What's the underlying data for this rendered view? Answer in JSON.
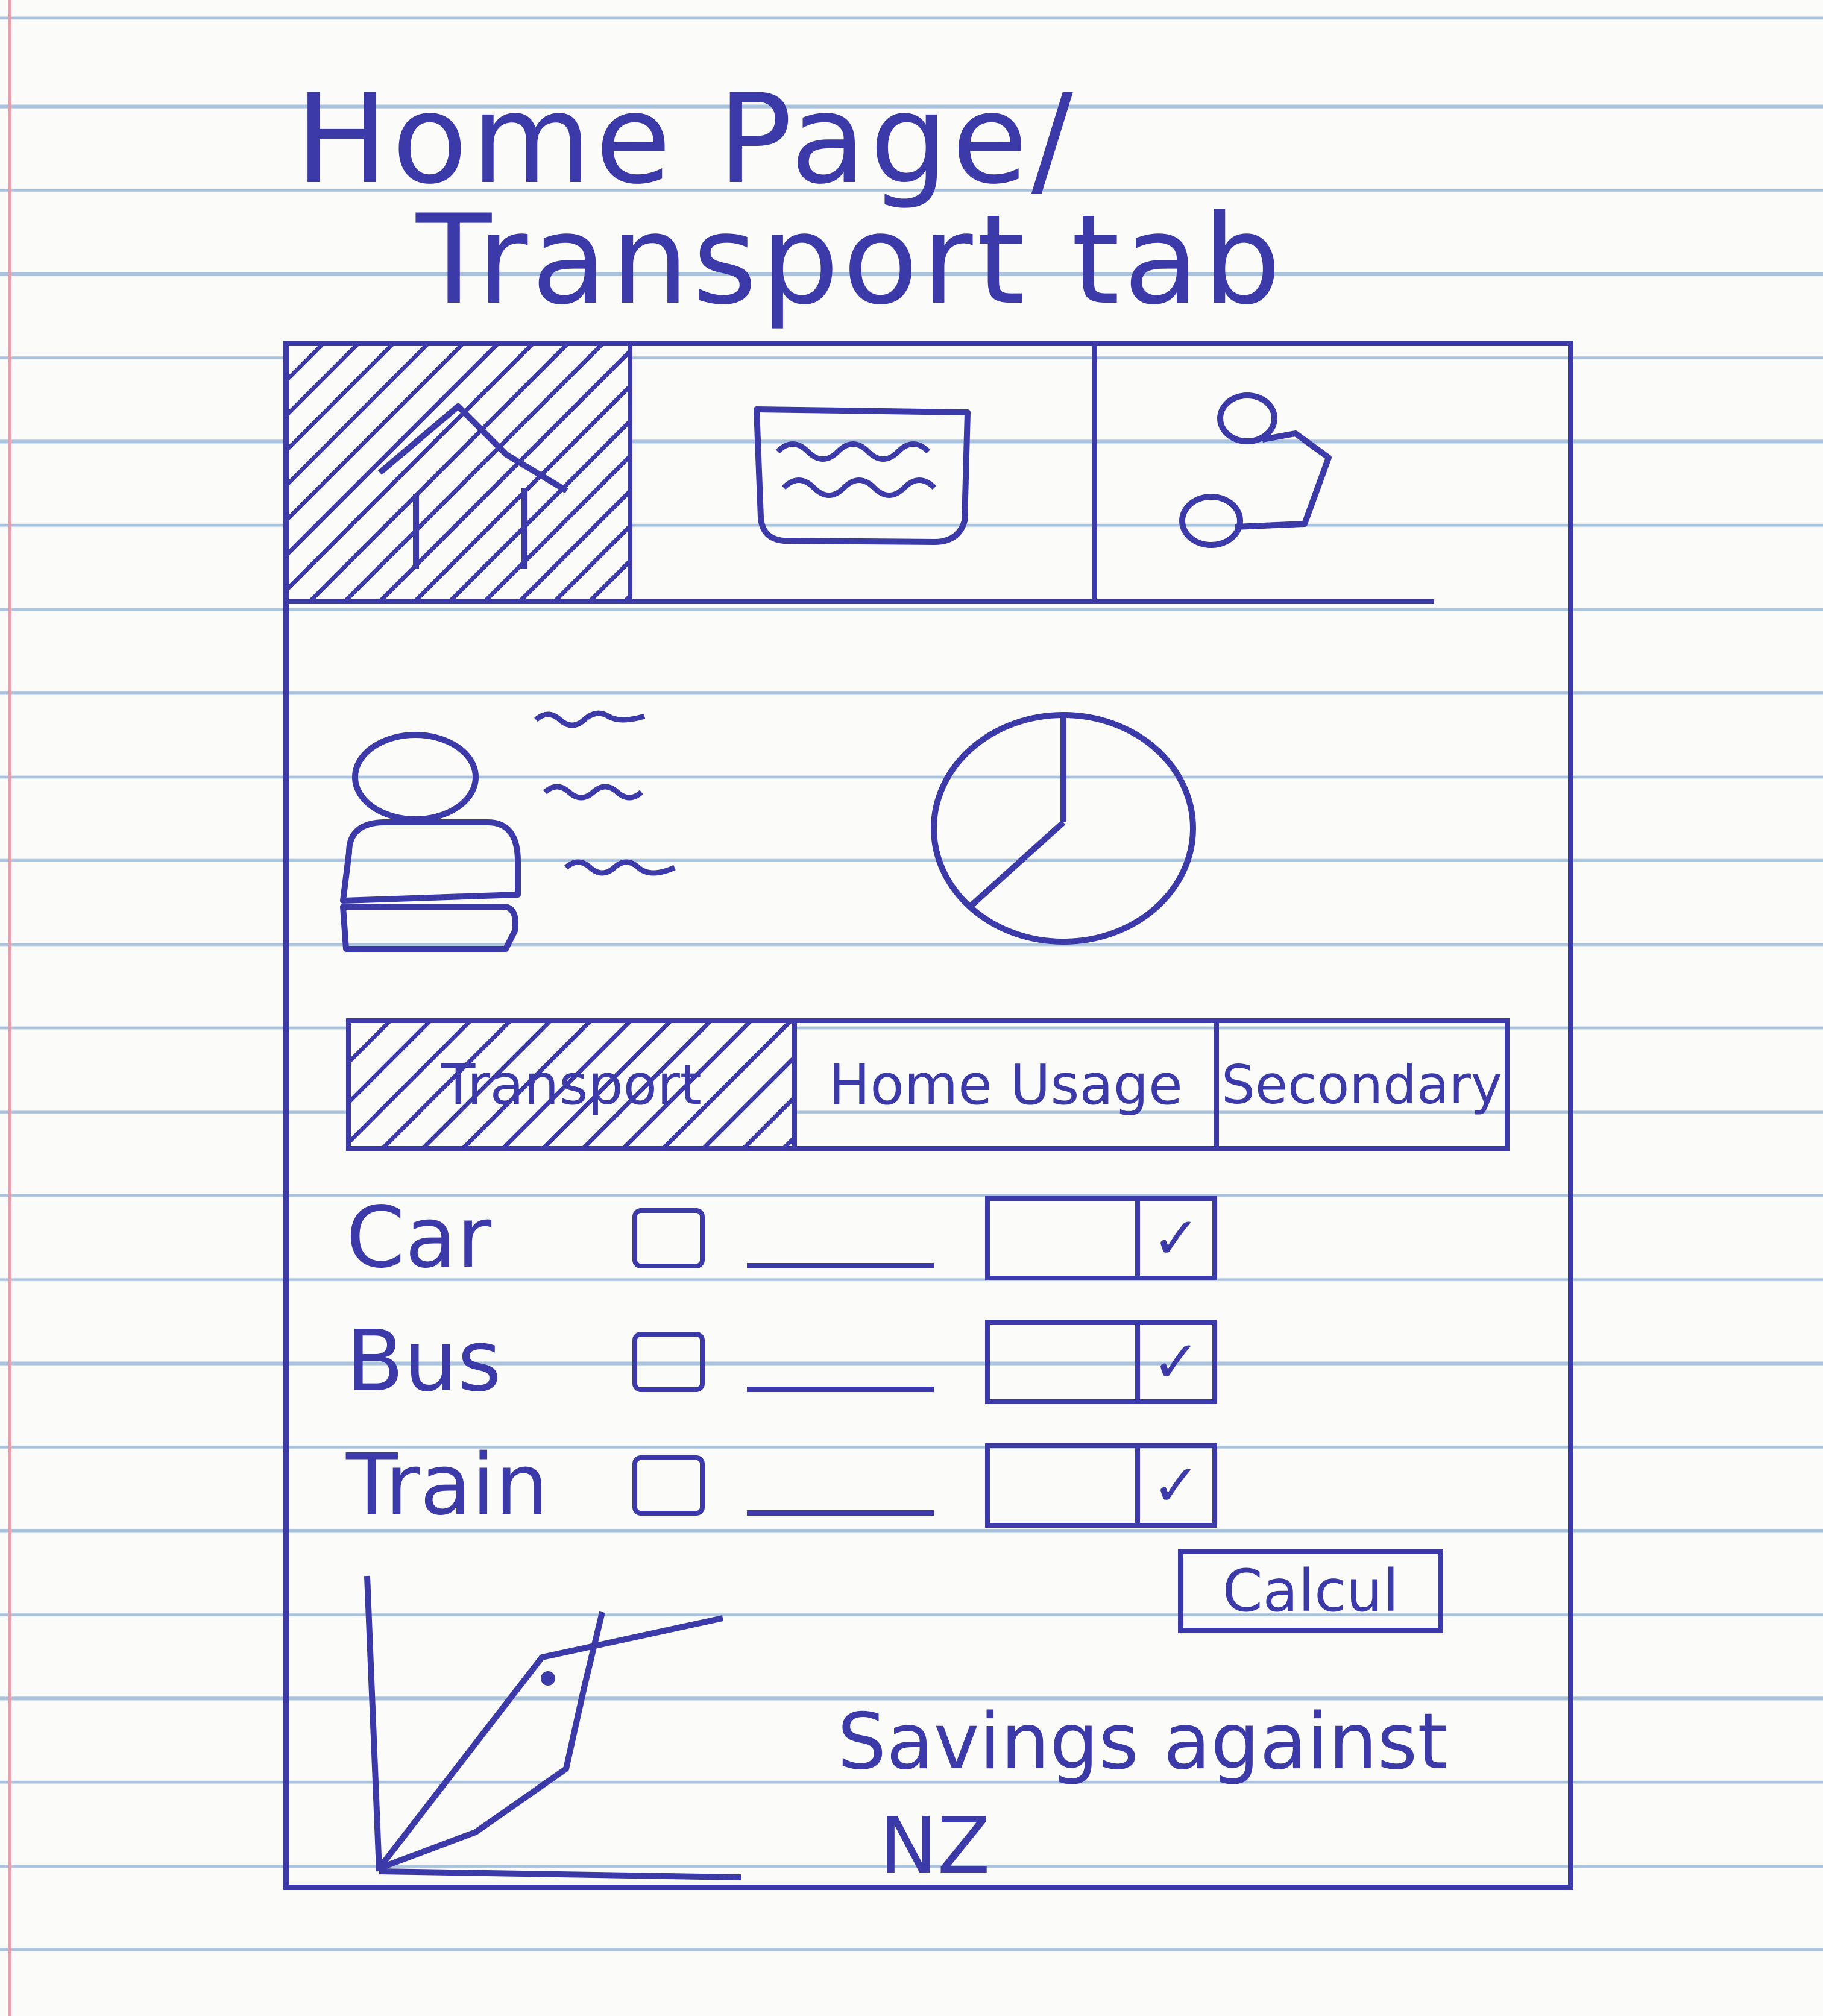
{
  "title": {
    "line1": "Home Page/",
    "line2": "Transport tab"
  },
  "nav": {
    "items": [
      {
        "icon": "home-icon",
        "active": true
      },
      {
        "icon": "newspaper-icon",
        "active": false
      },
      {
        "icon": "route-icon",
        "active": false
      }
    ]
  },
  "tabs": {
    "transport": "Transport",
    "home_usage": "Home Usage",
    "secondary": "Secondary",
    "active": "Transport"
  },
  "transport_rows": [
    {
      "label": "Car",
      "checked": true
    },
    {
      "label": "Bus",
      "checked": true
    },
    {
      "label": "Train",
      "checked": true
    }
  ],
  "toggle_check_glyph": "✓",
  "calculate_label": "Calcul",
  "chart_caption": {
    "line1": "Savings against",
    "line2": "NZ"
  },
  "colors": {
    "ink": "#3b3aa8",
    "paper": "#fbfbfa",
    "ruled_line": "#a9c3df",
    "margin_line": "#e4a0ac"
  }
}
